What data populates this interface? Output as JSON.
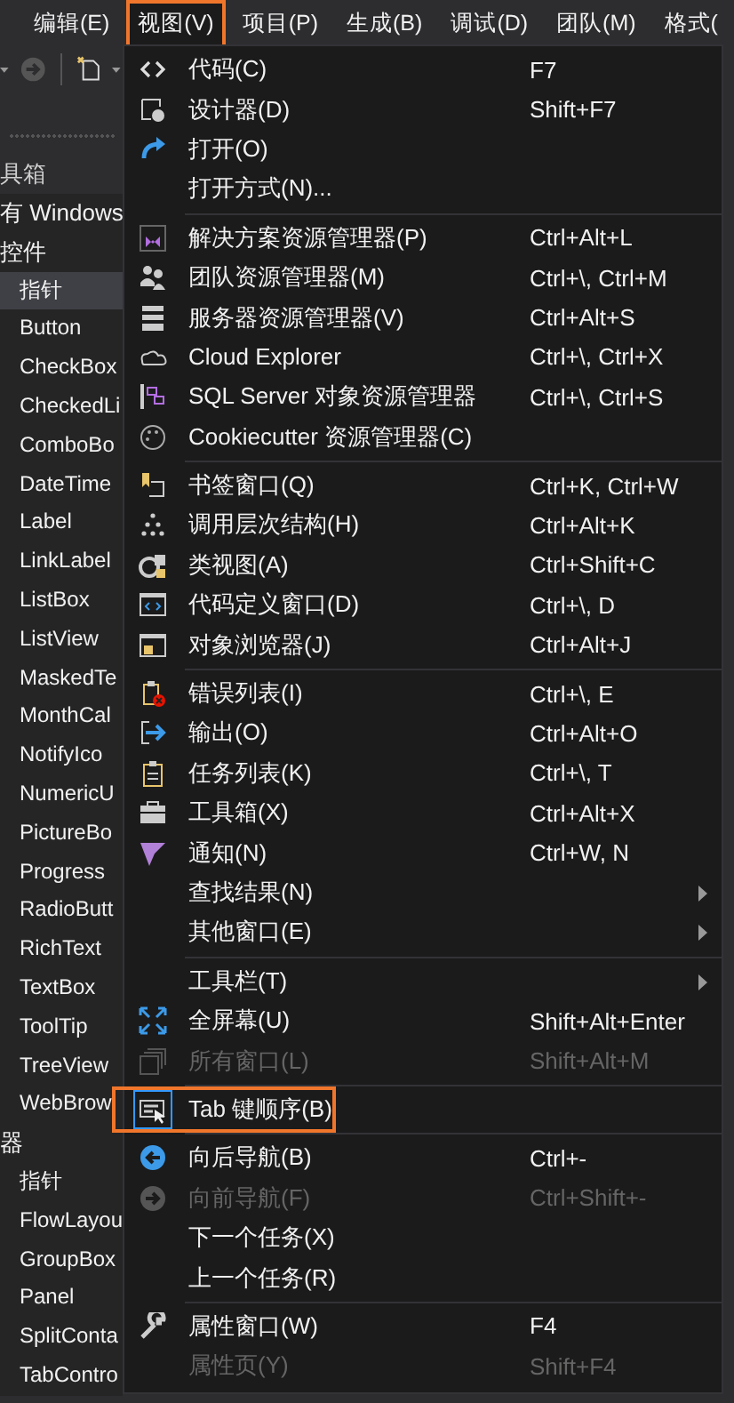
{
  "menubar": [
    {
      "label": "编辑(E)",
      "selected": false
    },
    {
      "label": "视图(V)",
      "selected": true,
      "highlighted": true
    },
    {
      "label": "项目(P)",
      "selected": false
    },
    {
      "label": "生成(B)",
      "selected": false
    },
    {
      "label": "调试(D)",
      "selected": false
    },
    {
      "label": "团队(M)",
      "selected": false
    },
    {
      "label": "格式(",
      "selected": false
    }
  ],
  "toolbox": {
    "title": "具箱",
    "rows": [
      {
        "kind": "group",
        "text": "有 Windows",
        "selected": false
      },
      {
        "kind": "group",
        "text": "控件",
        "selected": false
      },
      {
        "kind": "item",
        "text": "指针",
        "selected": true
      },
      {
        "kind": "item",
        "text": "Button",
        "selected": false
      },
      {
        "kind": "item",
        "text": "CheckBox",
        "selected": false
      },
      {
        "kind": "item",
        "text": "CheckedLi",
        "selected": false
      },
      {
        "kind": "item",
        "text": "ComboBo",
        "selected": false
      },
      {
        "kind": "item",
        "text": "DateTime",
        "selected": false
      },
      {
        "kind": "item",
        "text": "Label",
        "selected": false
      },
      {
        "kind": "item",
        "text": "LinkLabel",
        "selected": false
      },
      {
        "kind": "item",
        "text": "ListBox",
        "selected": false
      },
      {
        "kind": "item",
        "text": "ListView",
        "selected": false
      },
      {
        "kind": "item",
        "text": "MaskedTe",
        "selected": false
      },
      {
        "kind": "item",
        "text": "MonthCal",
        "selected": false
      },
      {
        "kind": "item",
        "text": "NotifyIco",
        "selected": false
      },
      {
        "kind": "item",
        "text": "NumericU",
        "selected": false
      },
      {
        "kind": "item",
        "text": "PictureBo",
        "selected": false
      },
      {
        "kind": "item",
        "text": "Progress",
        "selected": false
      },
      {
        "kind": "item",
        "text": "RadioButt",
        "selected": false
      },
      {
        "kind": "item",
        "text": "RichText",
        "selected": false
      },
      {
        "kind": "item",
        "text": "TextBox",
        "selected": false
      },
      {
        "kind": "item",
        "text": "ToolTip",
        "selected": false
      },
      {
        "kind": "item",
        "text": "TreeView",
        "selected": false
      },
      {
        "kind": "item",
        "text": "WebBrow",
        "selected": false
      },
      {
        "kind": "group",
        "text": "器",
        "selected": false
      },
      {
        "kind": "item",
        "text": "指针",
        "selected": false
      },
      {
        "kind": "item",
        "text": "FlowLayou",
        "selected": false
      },
      {
        "kind": "item",
        "text": "GroupBox",
        "selected": false
      },
      {
        "kind": "item",
        "text": "Panel",
        "selected": false
      },
      {
        "kind": "item",
        "text": "SplitConta",
        "selected": false
      },
      {
        "kind": "item",
        "text": "TabContro",
        "selected": false
      }
    ]
  },
  "menu": {
    "groups": [
      [
        {
          "label": "代码(C)",
          "shortcut": "F7",
          "disabled": false
        },
        {
          "label": "设计器(D)",
          "shortcut": "Shift+F7",
          "disabled": false
        },
        {
          "label": "打开(O)",
          "disabled": false
        },
        {
          "label": "打开方式(N)...",
          "disabled": false
        }
      ],
      [
        {
          "label": "解决方案资源管理器(P)",
          "shortcut": "Ctrl+Alt+L",
          "disabled": false
        },
        {
          "label": "团队资源管理器(M)",
          "shortcut": "Ctrl+\\, Ctrl+M",
          "disabled": false
        },
        {
          "label": "服务器资源管理器(V)",
          "shortcut": "Ctrl+Alt+S",
          "disabled": false
        },
        {
          "label": "Cloud Explorer",
          "shortcut": "Ctrl+\\, Ctrl+X",
          "disabled": false
        },
        {
          "label": "SQL Server 对象资源管理器",
          "shortcut": "Ctrl+\\, Ctrl+S",
          "disabled": false
        },
        {
          "label": "Cookiecutter 资源管理器(C)",
          "disabled": false
        }
      ],
      [
        {
          "label": "书签窗口(Q)",
          "shortcut": "Ctrl+K, Ctrl+W",
          "disabled": false
        },
        {
          "label": "调用层次结构(H)",
          "shortcut": "Ctrl+Alt+K",
          "disabled": false
        },
        {
          "label": "类视图(A)",
          "shortcut": "Ctrl+Shift+C",
          "disabled": false
        },
        {
          "label": "代码定义窗口(D)",
          "shortcut": "Ctrl+\\, D",
          "disabled": false
        },
        {
          "label": "对象浏览器(J)",
          "shortcut": "Ctrl+Alt+J",
          "disabled": false
        }
      ],
      [
        {
          "label": "错误列表(I)",
          "shortcut": "Ctrl+\\, E",
          "disabled": false
        },
        {
          "label": "输出(O)",
          "shortcut": "Ctrl+Alt+O",
          "disabled": false
        },
        {
          "label": "任务列表(K)",
          "shortcut": "Ctrl+\\, T",
          "disabled": false
        },
        {
          "label": "工具箱(X)",
          "shortcut": "Ctrl+Alt+X",
          "disabled": false
        },
        {
          "label": "通知(N)",
          "shortcut": "Ctrl+W, N",
          "disabled": false
        },
        {
          "label": "查找结果(N)",
          "disabled": false,
          "submenu": true
        },
        {
          "label": "其他窗口(E)",
          "disabled": false,
          "submenu": true
        }
      ],
      [
        {
          "label": "工具栏(T)",
          "disabled": false,
          "submenu": true
        },
        {
          "label": "全屏幕(U)",
          "shortcut": "Shift+Alt+Enter",
          "disabled": false
        },
        {
          "label": "所有窗口(L)",
          "shortcut": "Shift+Alt+M",
          "disabled": true
        }
      ],
      [
        {
          "label": "Tab 键顺序(B)",
          "disabled": false,
          "checked": true,
          "highlighted": true
        }
      ],
      [
        {
          "label": "向后导航(B)",
          "shortcut": "Ctrl+-",
          "disabled": false
        },
        {
          "label": "向前导航(F)",
          "shortcut": "Ctrl+Shift+-",
          "disabled": true
        },
        {
          "label": "下一个任务(X)",
          "disabled": false
        },
        {
          "label": "上一个任务(R)",
          "disabled": false
        }
      ],
      [
        {
          "label": "属性窗口(W)",
          "shortcut": "F4",
          "disabled": false
        },
        {
          "label": "属性页(Y)",
          "shortcut": "Shift+F4",
          "disabled": true
        }
      ]
    ]
  }
}
